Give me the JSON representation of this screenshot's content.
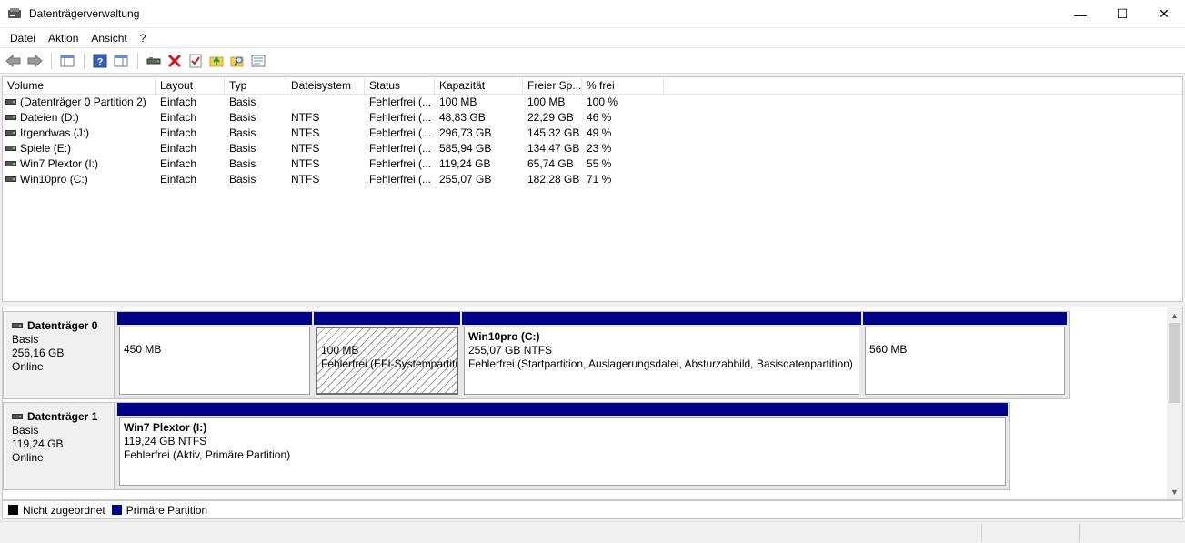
{
  "window": {
    "title": "Datenträgerverwaltung",
    "minimize_glyph": "—",
    "maximize_glyph": "☐",
    "close_glyph": "✕"
  },
  "menu": [
    "Datei",
    "Aktion",
    "Ansicht",
    "?"
  ],
  "toolbar": {
    "icons": [
      "back-icon",
      "forward-icon",
      "console-tree-icon",
      "help-icon",
      "show-pane-icon",
      "connect-drive-icon",
      "delete-icon",
      "check-icon",
      "folder-up-icon",
      "search-folder-icon",
      "properties-icon"
    ]
  },
  "volume_list": {
    "columns": [
      "Volume",
      "Layout",
      "Typ",
      "Dateisystem",
      "Status",
      "Kapazität",
      "Freier Sp...",
      "% frei"
    ],
    "rows": [
      [
        "(Datenträger 0 Partition 2)",
        "Einfach",
        "Basis",
        "",
        "Fehlerfrei (...",
        "100 MB",
        "100 MB",
        "100 %"
      ],
      [
        "Dateien (D:)",
        "Einfach",
        "Basis",
        "NTFS",
        "Fehlerfrei (...",
        "48,83 GB",
        "22,29 GB",
        "46 %"
      ],
      [
        "Irgendwas (J:)",
        "Einfach",
        "Basis",
        "NTFS",
        "Fehlerfrei (...",
        "296,73 GB",
        "145,32 GB",
        "49 %"
      ],
      [
        "Spiele (E:)",
        "Einfach",
        "Basis",
        "NTFS",
        "Fehlerfrei (...",
        "585,94 GB",
        "134,47 GB",
        "23 %"
      ],
      [
        "Win7 Plextor (I:)",
        "Einfach",
        "Basis",
        "NTFS",
        "Fehlerfrei (...",
        "119,24 GB",
        "65,74 GB",
        "55 %"
      ],
      [
        "Win10pro (C:)",
        "Einfach",
        "Basis",
        "NTFS",
        "Fehlerfrei (...",
        "255,07 GB",
        "182,28 GB",
        "71 %"
      ]
    ]
  },
  "disks": [
    {
      "name": "Datenträger 0",
      "type": "Basis",
      "size": "256,16 GB",
      "state": "Online",
      "partitions": [
        {
          "name": "",
          "size": "450 MB",
          "status": "",
          "selected": false
        },
        {
          "name": "",
          "size": "100 MB",
          "status": "Fehlerfrei (EFI-Systempartition)",
          "selected": true
        },
        {
          "name": "Win10pro  (C:)",
          "size": "255,07 GB NTFS",
          "status": "Fehlerfrei (Startpartition, Auslagerungsdatei, Absturzabbild, Basisdatenpartition)",
          "selected": false
        },
        {
          "name": "",
          "size": "560 MB",
          "status": "",
          "selected": false
        }
      ]
    },
    {
      "name": "Datenträger 1",
      "type": "Basis",
      "size": "119,24 GB",
      "state": "Online",
      "partitions": [
        {
          "name": "Win7 Plextor  (I:)",
          "size": "119,24 GB NTFS",
          "status": "Fehlerfrei (Aktiv, Primäre Partition)",
          "selected": false
        }
      ]
    }
  ],
  "legend": [
    {
      "label": "Nicht zugeordnet",
      "color": "#000000"
    },
    {
      "label": "Primäre Partition",
      "color": "#00008b"
    }
  ],
  "colors": {
    "primary_partition": "#00008b",
    "unallocated": "#000000"
  }
}
